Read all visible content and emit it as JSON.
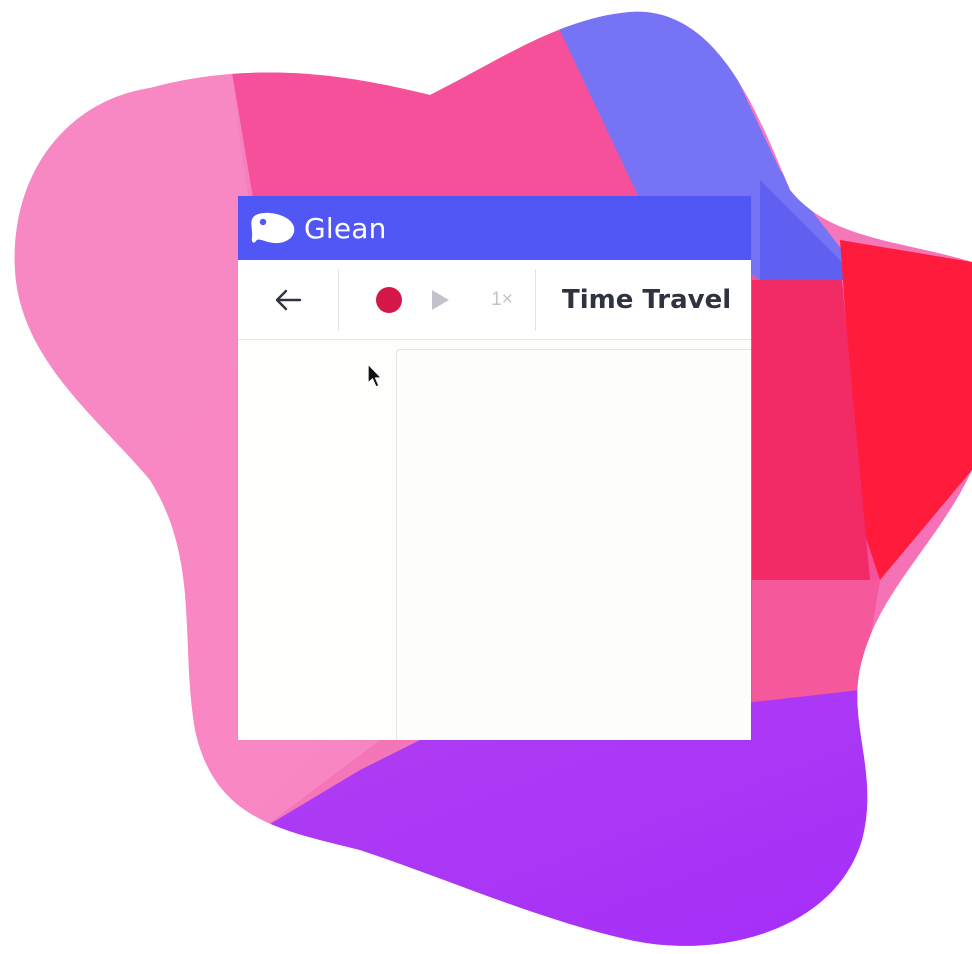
{
  "app": {
    "name": "Glean",
    "brand_color": "#5057f5",
    "logo_icon": "glean-logo-icon"
  },
  "toolbar": {
    "back_icon": "arrow-left-icon",
    "record_icon": "record-icon",
    "record_color": "#d5174a",
    "play_icon": "play-icon",
    "speed_label": "1×",
    "title": "Time Travel"
  },
  "background": {
    "shape": "blob",
    "colors": [
      "#f57fbf",
      "#f5509a",
      "#7674f5",
      "#ff1b3c",
      "#a331f8"
    ]
  },
  "cursor": {
    "icon": "mouse-pointer-icon"
  }
}
